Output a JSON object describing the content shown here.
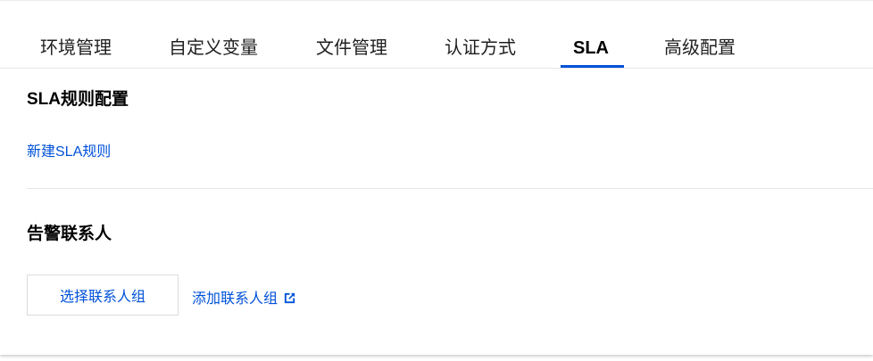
{
  "tabs": [
    {
      "label": "环境管理",
      "active": false
    },
    {
      "label": "自定义变量",
      "active": false
    },
    {
      "label": "文件管理",
      "active": false
    },
    {
      "label": "认证方式",
      "active": false
    },
    {
      "label": "SLA",
      "active": true
    },
    {
      "label": "高级配置",
      "active": false
    }
  ],
  "sla_section": {
    "title": "SLA规则配置",
    "create_link": "新建SLA规则"
  },
  "alert_section": {
    "title": "告警联系人",
    "select_button": "选择联系人组",
    "add_link": "添加联系人组",
    "add_link_icon": "external-link-icon"
  },
  "colors": {
    "accent": "#0052d9",
    "text": "#1f1f1f",
    "divider": "#e7e7e7"
  }
}
